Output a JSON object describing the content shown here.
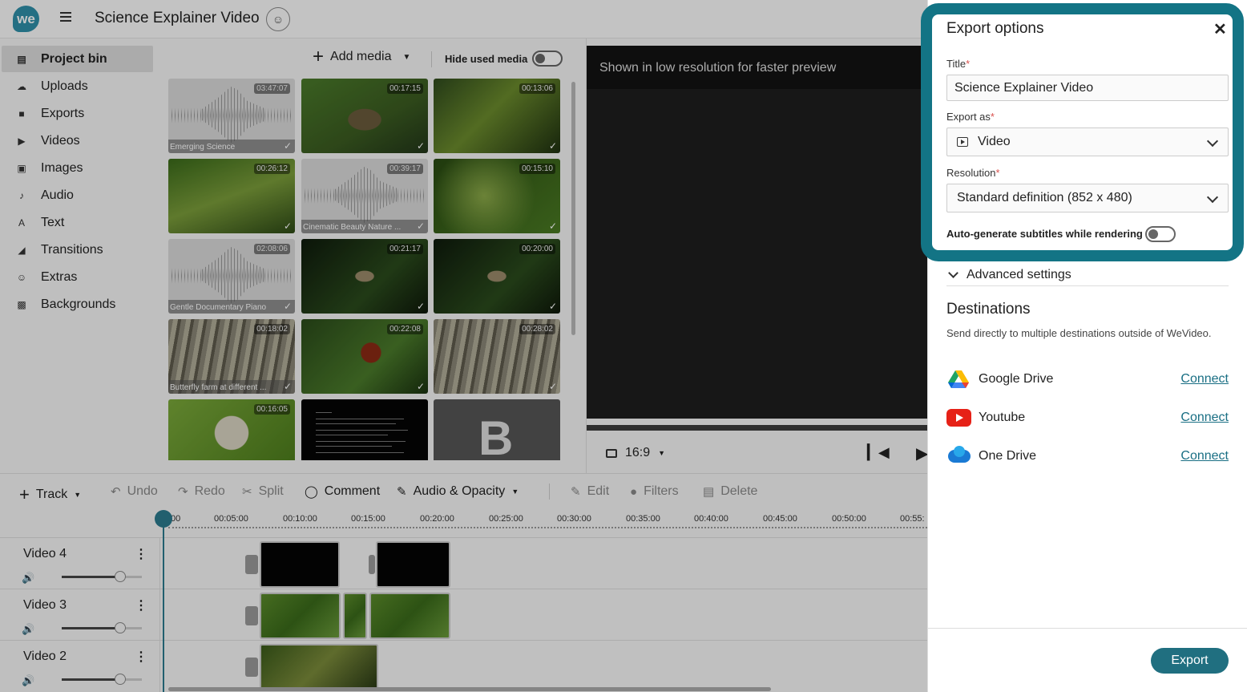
{
  "app": {
    "logo": "we",
    "title": "Science Explainer Video"
  },
  "sidebar": {
    "items": [
      {
        "label": "Project bin",
        "icon": "project-bin-icon"
      },
      {
        "label": "Uploads",
        "icon": "cloud-upload-icon"
      },
      {
        "label": "Exports",
        "icon": "exports-icon"
      },
      {
        "label": "Videos",
        "icon": "video-icon"
      },
      {
        "label": "Images",
        "icon": "image-icon"
      },
      {
        "label": "Audio",
        "icon": "music-note-icon"
      },
      {
        "label": "Text",
        "icon": "text-icon"
      },
      {
        "label": "Transitions",
        "icon": "transitions-icon"
      },
      {
        "label": "Extras",
        "icon": "smiley-icon"
      },
      {
        "label": "Backgrounds",
        "icon": "backgrounds-icon"
      }
    ]
  },
  "media": {
    "add_label": "Add media",
    "hide_used_label": "Hide used media",
    "thumbs": [
      {
        "duration": "03:47:07",
        "caption": "Emerging Science"
      },
      {
        "duration": "00:17:15",
        "caption": ""
      },
      {
        "duration": "00:13:06",
        "caption": ""
      },
      {
        "duration": "00:26:12",
        "caption": ""
      },
      {
        "duration": "00:39:17",
        "caption": "Cinematic Beauty Nature ..."
      },
      {
        "duration": "00:15:10",
        "caption": ""
      },
      {
        "duration": "02:08:06",
        "caption": "Gentle Documentary Piano"
      },
      {
        "duration": "00:21:17",
        "caption": ""
      },
      {
        "duration": "00:20:00",
        "caption": ""
      },
      {
        "duration": "00:18:02",
        "caption": "Butterfly farm at different ..."
      },
      {
        "duration": "00:22:08",
        "caption": ""
      },
      {
        "duration": "00:28:02",
        "caption": ""
      },
      {
        "duration": "00:16:05",
        "caption": ""
      },
      {
        "duration": "",
        "caption": ""
      },
      {
        "duration": "",
        "caption": ""
      }
    ]
  },
  "preview": {
    "banner": "Shown in low resolution for faster preview",
    "ratio": "16:9"
  },
  "toolbar": {
    "track": "Track",
    "undo": "Undo",
    "redo": "Redo",
    "split": "Split",
    "comment": "Comment",
    "audio_opacity": "Audio & Opacity",
    "edit": "Edit",
    "filters": "Filters",
    "delete": "Delete"
  },
  "ruler": {
    "ticks": [
      "00",
      "00:05:00",
      "00:10:00",
      "00:15:00",
      "00:20:00",
      "00:25:00",
      "00:30:00",
      "00:35:00",
      "00:40:00",
      "00:45:00",
      "00:50:00",
      "00:55:"
    ]
  },
  "tracks": [
    {
      "name": "Video 4",
      "volume": 0.72
    },
    {
      "name": "Video 3",
      "volume": 0.72
    },
    {
      "name": "Video 2",
      "volume": 0.72
    }
  ],
  "export": {
    "title": "Export options",
    "title_label": "Title",
    "title_value": "Science Explainer Video",
    "export_as_label": "Export as",
    "export_as_value": "Video",
    "resolution_label": "Resolution",
    "resolution_value": "Standard definition (852 x 480)",
    "subtitles_label": "Auto-generate subtitles while rendering",
    "subtitles_enabled": false,
    "advanced_label": "Advanced settings",
    "destinations_title": "Destinations",
    "destinations_subtitle": "Send directly to multiple destinations outside of WeVideo.",
    "destinations": [
      {
        "name": "Google Drive",
        "action": "Connect",
        "icon": "google-drive-icon"
      },
      {
        "name": "Youtube",
        "action": "Connect",
        "icon": "youtube-icon"
      },
      {
        "name": "One Drive",
        "action": "Connect",
        "icon": "onedrive-icon"
      }
    ],
    "export_button": "Export",
    "highlight_color": "#137485",
    "button_color": "#206f80"
  }
}
